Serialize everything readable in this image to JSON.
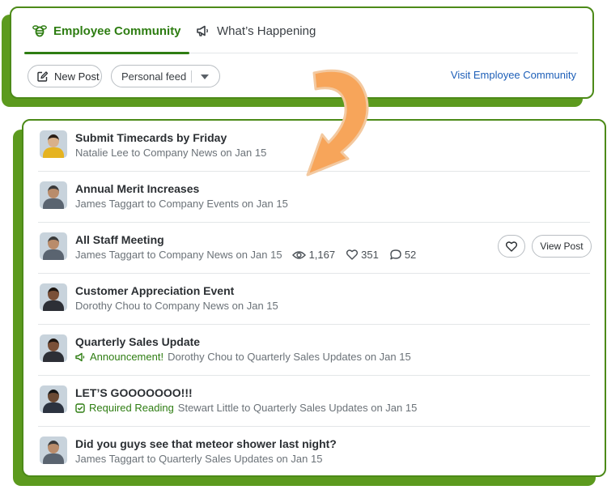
{
  "tabs": {
    "community_label": "Employee Community",
    "happening_label": "What’s Happening"
  },
  "toolbar": {
    "new_post_label": "New Post",
    "feed_selected": "Personal feed",
    "visit_link_label": "Visit Employee Community"
  },
  "posts": [
    {
      "title": "Submit Timecards by Friday",
      "byline": "Natalie Lee to Company News on Jan 15",
      "tag": "",
      "avatar_hair": "#2a1e16",
      "avatar_skin": "#d9b08a",
      "avatar_shirt": "#e5b321"
    },
    {
      "title": "Annual Merit Increases",
      "byline": "James Taggart to Company Events on Jan 15",
      "tag": "",
      "avatar_hair": "#3a3a3a",
      "avatar_skin": "#b98c6b",
      "avatar_shirt": "#5a6470"
    },
    {
      "title": "All Staff Meeting",
      "byline": "James Taggart to Company News on Jan 15",
      "tag": "",
      "views": "1,167",
      "likes": "351",
      "comments": "52",
      "view_button_label": "View Post",
      "avatar_hair": "#3a3a3a",
      "avatar_skin": "#b98c6b",
      "avatar_shirt": "#5a6470"
    },
    {
      "title": "Customer Appreciation Event",
      "byline": "Dorothy Chou to Company News on Jan 15",
      "tag": "",
      "avatar_hair": "#1d1510",
      "avatar_skin": "#7a5038",
      "avatar_shirt": "#2d2f36"
    },
    {
      "title": "Quarterly Sales Update",
      "byline": "Dorothy Chou to Quarterly Sales Updates on Jan 15",
      "tag": "Announcement!",
      "tag_icon": "megaphone-icon",
      "avatar_hair": "#1d1510",
      "avatar_skin": "#7a5038",
      "avatar_shirt": "#2d2f36"
    },
    {
      "title": "LET’S GOOOOOOO!!!",
      "byline": "Stewart Little to Quarterly Sales Updates on Jan 15",
      "tag": "Required Reading",
      "tag_icon": "checkbox-icon",
      "avatar_hair": "#141414",
      "avatar_skin": "#6b4a34",
      "avatar_shirt": "#2c3340"
    },
    {
      "title": "Did you guys see that meteor shower last night?",
      "byline": "James Taggart to Quarterly Sales Updates on Jan 15",
      "tag": "",
      "avatar_hair": "#3a3a3a",
      "avatar_skin": "#b98c6b",
      "avatar_shirt": "#5a6470"
    }
  ],
  "colors": {
    "brand_green": "#2e7d12",
    "shadow_green": "#5c9a1e",
    "link_blue": "#1d5fb8",
    "arrow_orange": "#f7a55a"
  }
}
